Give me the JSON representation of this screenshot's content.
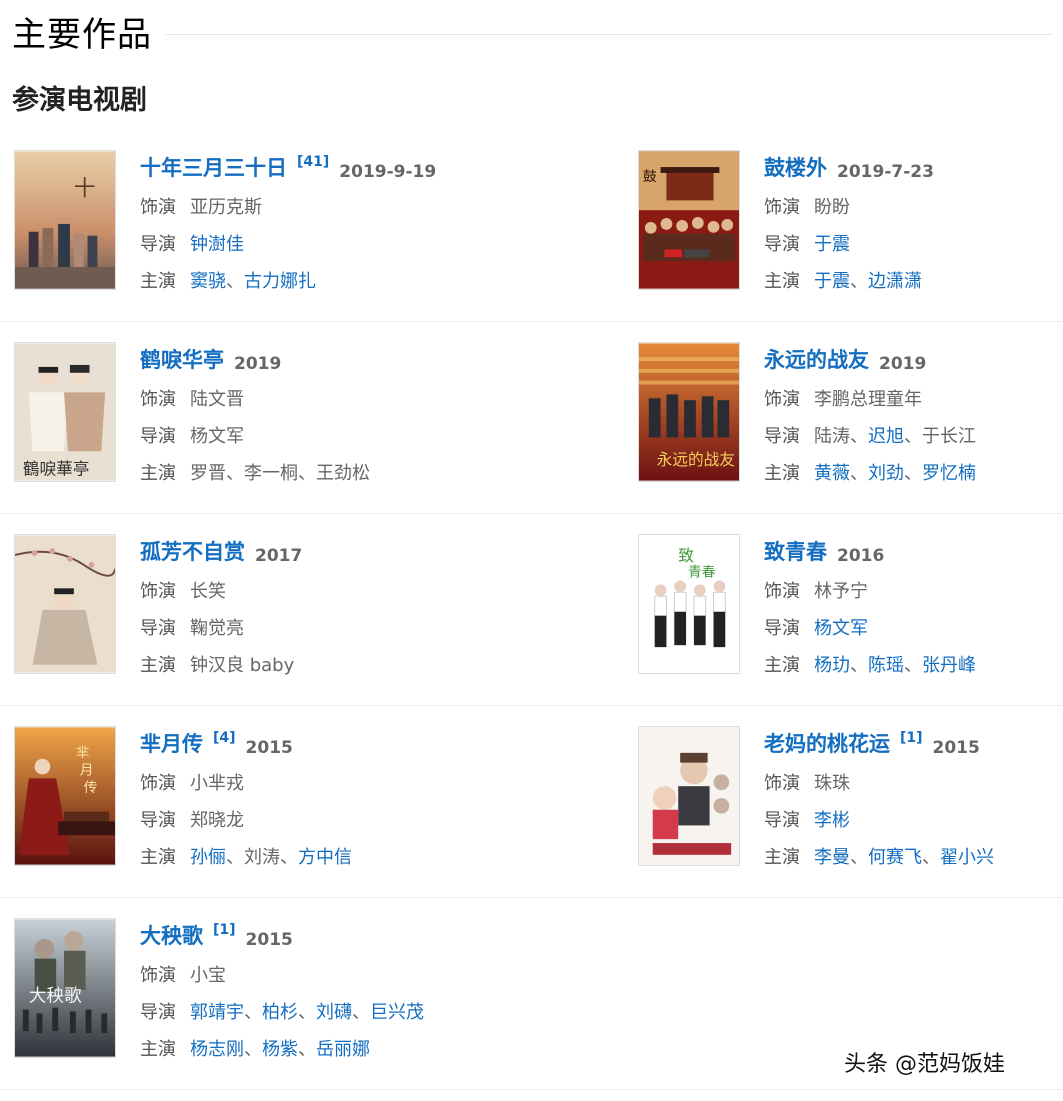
{
  "header": {
    "title": "主要作品"
  },
  "subheader": {
    "title": "参演电视剧"
  },
  "works": [
    {
      "title": "十年三月三十日",
      "ref": "[41]",
      "year": "2019-9-19",
      "role_label": "饰演",
      "role": "亚历克斯",
      "director_label": "导演",
      "directors": [
        "钟澍佳"
      ],
      "directors_linked": true,
      "cast_label": "主演",
      "cast": [
        "窦骁",
        "古力娜扎"
      ],
      "cast_linked": true
    },
    {
      "title": "鼓楼外",
      "ref": "",
      "year": "2019-7-23",
      "role_label": "饰演",
      "role": "盼盼",
      "director_label": "导演",
      "directors": [
        "于震"
      ],
      "directors_linked": true,
      "cast_label": "主演",
      "cast": [
        "于震",
        "边潇潇"
      ],
      "cast_linked": true
    },
    {
      "title": "鹤唳华亭",
      "ref": "",
      "year": "2019",
      "role_label": "饰演",
      "role": "陆文晋",
      "director_label": "导演",
      "directors": [
        "杨文军"
      ],
      "directors_linked": false,
      "cast_label": "主演",
      "cast": [
        "罗晋",
        "李一桐",
        "王劲松"
      ],
      "cast_linked": false
    },
    {
      "title": "永远的战友",
      "ref": "",
      "year": "2019",
      "role_label": "饰演",
      "role": "李鹏总理童年",
      "director_label": "导演",
      "directors": [
        "陆涛",
        "迟旭",
        "于长江"
      ],
      "directors_linked": [
        false,
        true,
        false
      ],
      "cast_label": "主演",
      "cast": [
        "黄薇",
        "刘劲",
        "罗忆楠"
      ],
      "cast_linked": true
    },
    {
      "title": "孤芳不自赏",
      "ref": "",
      "year": "2017",
      "role_label": "饰演",
      "role": "长笑",
      "director_label": "导演",
      "directors": [
        "鞠觉亮"
      ],
      "directors_linked": false,
      "cast_label": "主演",
      "cast": [
        "钟汉良 baby"
      ],
      "cast_linked": false
    },
    {
      "title": "致青春",
      "ref": "",
      "year": "2016",
      "role_label": "饰演",
      "role": "林予宁",
      "director_label": "导演",
      "directors": [
        "杨文军"
      ],
      "directors_linked": true,
      "cast_label": "主演",
      "cast": [
        "杨玏",
        "陈瑶",
        "张丹峰"
      ],
      "cast_linked": true
    },
    {
      "title": "芈月传",
      "ref": "[4]",
      "year": "2015",
      "role_label": "饰演",
      "role": "小芈戎",
      "director_label": "导演",
      "directors": [
        "郑晓龙"
      ],
      "directors_linked": false,
      "cast_label": "主演",
      "cast": [
        "孙俪",
        "刘涛",
        "方中信"
      ],
      "cast_linked": [
        true,
        false,
        true
      ]
    },
    {
      "title": "老妈的桃花运",
      "ref": "[1]",
      "year": "2015",
      "role_label": "饰演",
      "role": "珠珠",
      "director_label": "导演",
      "directors": [
        "李彬"
      ],
      "directors_linked": true,
      "cast_label": "主演",
      "cast": [
        "李曼",
        "何赛飞",
        "翟小兴"
      ],
      "cast_linked": true
    },
    {
      "title": "大秧歌",
      "ref": "[1]",
      "year": "2015",
      "role_label": "饰演",
      "role": "小宝",
      "director_label": "导演",
      "directors": [
        "郭靖宇",
        "柏杉",
        "刘礴",
        "巨兴茂"
      ],
      "directors_linked": true,
      "cast_label": "主演",
      "cast": [
        "杨志刚",
        "杨紫",
        "岳丽娜"
      ],
      "cast_linked": true
    }
  ],
  "separator": "、",
  "watermark": "头条 @范妈饭娃",
  "colors": {
    "link": "#136ec2",
    "text": "#666666",
    "rule": "#ececec"
  }
}
